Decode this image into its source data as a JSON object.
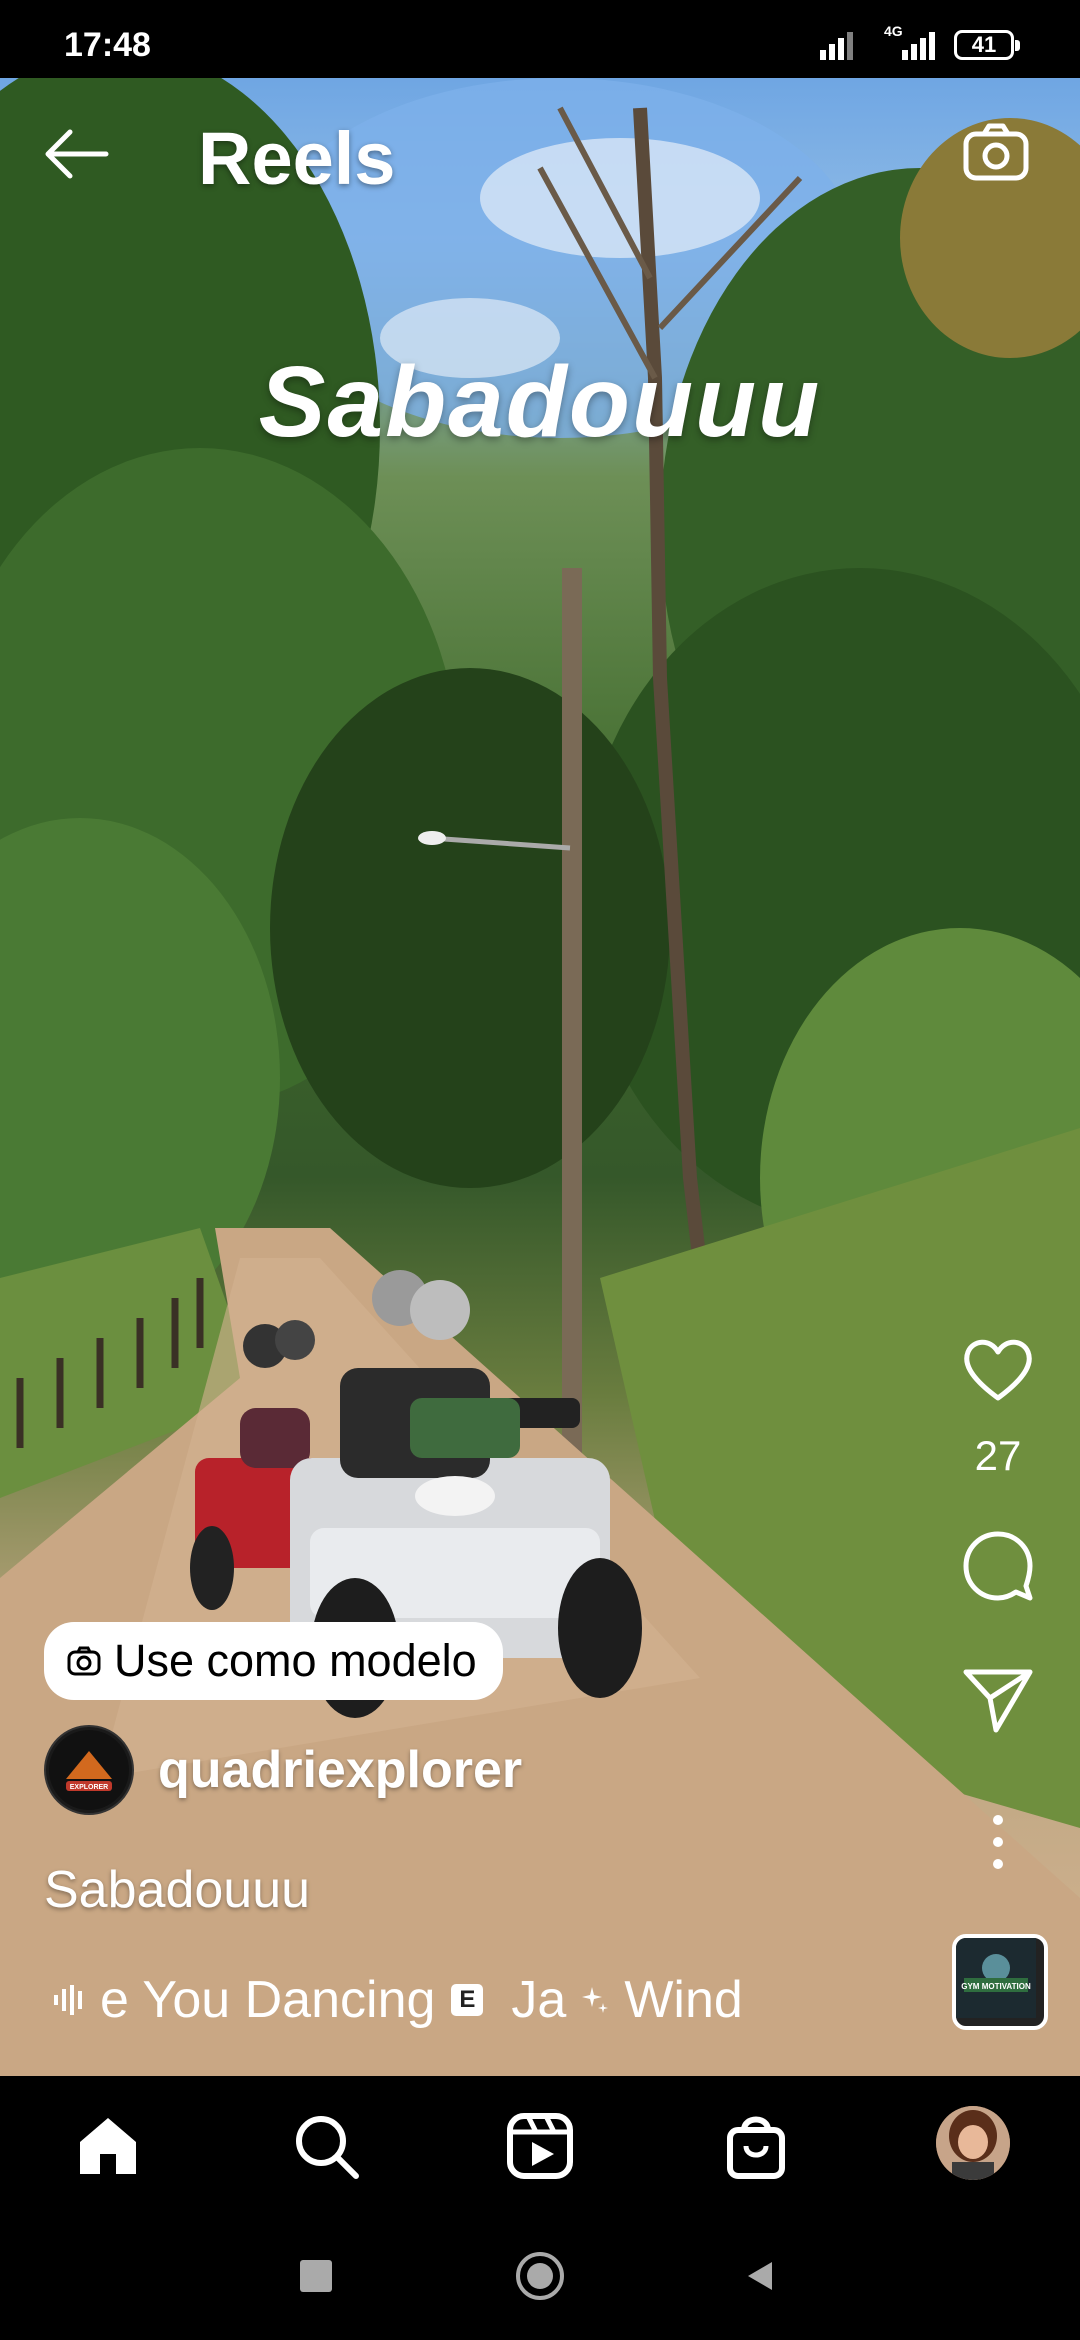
{
  "status": {
    "time": "17:48",
    "network": "4G",
    "battery": "41"
  },
  "header": {
    "title": "Reels"
  },
  "video": {
    "overlay_text": "Sabadouuu"
  },
  "actions": {
    "like_count": "27"
  },
  "template_button": {
    "label": "Use como modelo"
  },
  "author": {
    "username": "quadriexplorer",
    "avatar_text": "EXPLORER"
  },
  "caption": "Sabadouuu",
  "audio": {
    "track_1": "e You Dancing",
    "explicit_badge": "E",
    "separator_text": "Ja",
    "track_2": "Wind",
    "thumb_text": "GYM MOTIVATION"
  },
  "icons": {
    "back": "arrow-left-icon",
    "camera": "camera-icon",
    "like": "heart-icon",
    "comment": "comment-bubble-icon",
    "share": "paper-plane-icon",
    "more": "more-vertical-icon",
    "nav": [
      "home-icon",
      "search-icon",
      "reels-icon",
      "shop-icon",
      "profile-avatar"
    ],
    "system": [
      "recents-square-icon",
      "home-circle-icon",
      "back-triangle-icon"
    ]
  }
}
